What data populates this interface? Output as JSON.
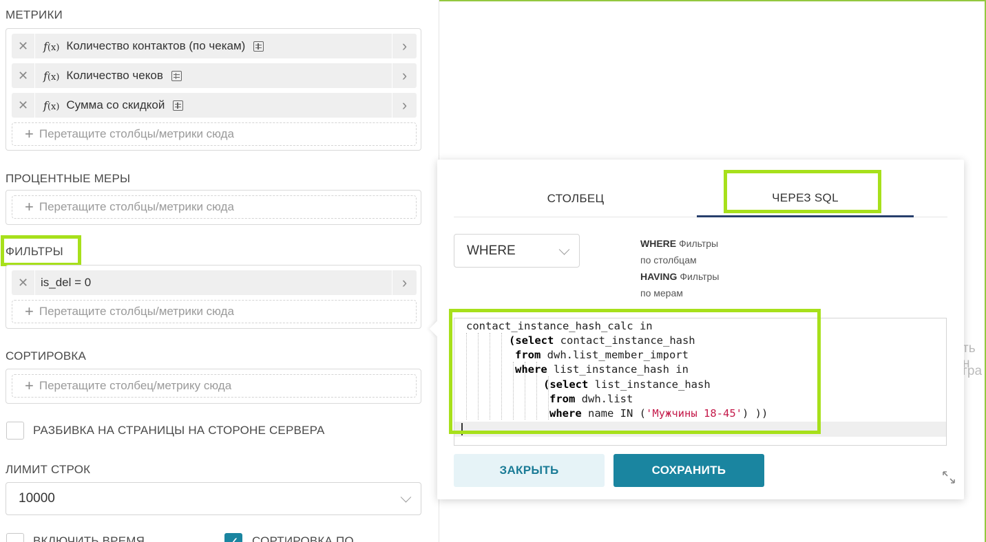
{
  "metrics": {
    "title": "МЕТРИКИ",
    "items": [
      {
        "label": "Количество контактов (по чекам)"
      },
      {
        "label": "Количество чеков"
      },
      {
        "label": "Сумма со скидкой"
      }
    ],
    "fx_label": "f",
    "fx_sub": "(x)",
    "drop_placeholder": "Перетащите столбцы/метрики сюда"
  },
  "percent_measures": {
    "title": "ПРОЦЕНТНЫЕ МЕРЫ",
    "drop_placeholder": "Перетащите столбцы/метрики сюда"
  },
  "filters": {
    "title": "ФИЛЬТРЫ",
    "items": [
      {
        "label": "is_del = 0"
      }
    ],
    "drop_placeholder": "Перетащите столбцы/метрики сюда"
  },
  "sorting": {
    "title": "СОРТИРОВКА",
    "drop_placeholder": "Перетащите столбец/метрику сюда"
  },
  "server_pagination": {
    "label": "РАЗБИВКА НА СТРАНИЦЫ НА СТОРОНЕ СЕРВЕРА",
    "checked": false
  },
  "row_limit": {
    "title": "ЛИМИТ СТРОК",
    "value": "10000"
  },
  "include_time": {
    "label": "ВКЛЮЧИТЬ ВРЕМЯ",
    "checked": false
  },
  "sort_by": {
    "label": "СОРТИРОВКА ПО",
    "checked": true
  },
  "popover": {
    "tabs": [
      {
        "label": "СТОЛБЕЦ",
        "active": false
      },
      {
        "label": "ЧЕРЕЗ SQL",
        "active": true
      }
    ],
    "clause_select": {
      "value": "WHERE"
    },
    "help": {
      "where_kw": "WHERE",
      "where_text1": "Фильтры",
      "where_text2": "по столбцам",
      "having_kw": "HAVING",
      "having_text1": "Фильтры",
      "having_text2": "по мерам"
    },
    "sql": {
      "l1": "contact_instance_hash_calc in",
      "l2_open": "(",
      "l2_kw": "select",
      "l2_rest": " contact_instance_hash",
      "l3_kw": "from",
      "l3_rest": " dwh.list_member_import",
      "l4_kw": "where",
      "l4_rest": " list_instance_hash in",
      "l5_open": "(",
      "l5_kw": "select",
      "l5_rest": " list_instance_hash",
      "l6_kw": "from",
      "l6_rest": " dwh.list",
      "l7_kw": "where",
      "l7_mid": " name IN (",
      "l7_str": "'Мужчины 18-45'",
      "l7_end": ") ))"
    },
    "close_label": "ЗАКРЫТЬ",
    "save_label": "СОХРАНИТЬ"
  },
  "background_text": {
    "line1": "ть н",
    "line2": "гра"
  },
  "colors": {
    "highlight": "#a7e01b",
    "primary": "#1a85a0",
    "tab_underline": "#263e6c",
    "frame": "#93c83f"
  }
}
